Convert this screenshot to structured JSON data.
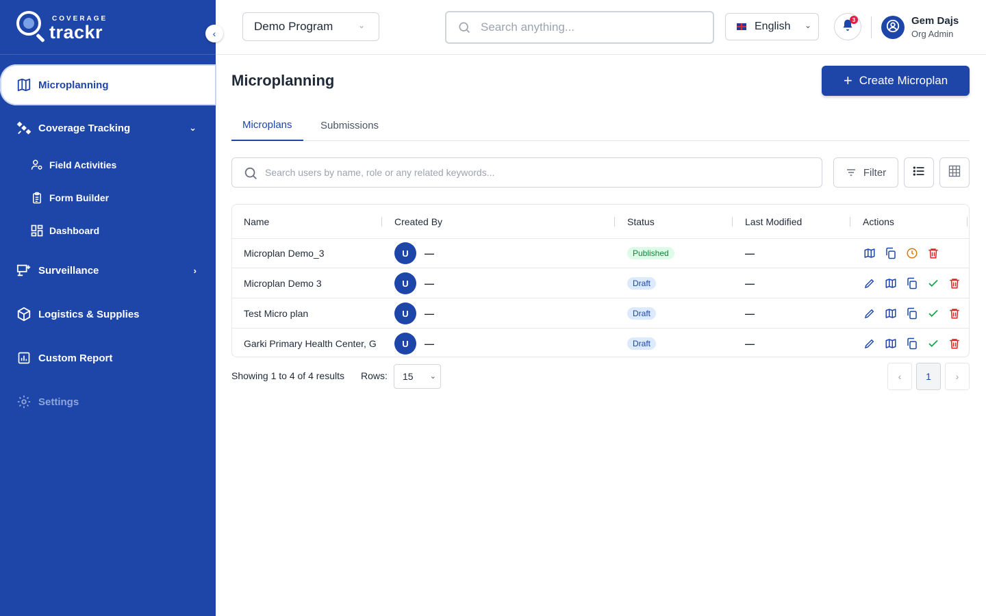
{
  "brand": {
    "sup": "COVERAGE",
    "name": "trackr"
  },
  "sidebar": {
    "collapse_icon": "chevron-left-icon",
    "items": [
      {
        "label": "Microplanning",
        "icon": "map-icon"
      },
      {
        "label": "Coverage Tracking",
        "icon": "satellite-icon",
        "expanded": true
      },
      {
        "label": "Field Activities",
        "icon": "user-cog-icon"
      },
      {
        "label": "Form Builder",
        "icon": "clipboard-icon"
      },
      {
        "label": "Dashboard",
        "icon": "dashboard-icon"
      },
      {
        "label": "Surveillance",
        "icon": "surveillance-icon"
      },
      {
        "label": "Logistics & Supplies",
        "icon": "box-icon"
      },
      {
        "label": "Custom Report",
        "icon": "report-icon"
      },
      {
        "label": "Settings",
        "icon": "gear-icon"
      }
    ]
  },
  "topbar": {
    "program": "Demo Program",
    "search_placeholder": "Search anything...",
    "language": "English",
    "notification_count": "3",
    "user_name": "Gem Dajs",
    "user_role": "Org Admin"
  },
  "main": {
    "title": "Microplanning",
    "create_label": "Create Microplan",
    "tabs": [
      {
        "label": "Microplans",
        "active": true
      },
      {
        "label": "Submissions",
        "active": false
      }
    ],
    "search_placeholder": "Search users by name, role or any related keywords...",
    "filter_label": "Filter"
  },
  "table": {
    "columns": [
      "Name",
      "Created By",
      "Status",
      "Last Modified",
      "Actions"
    ],
    "rows": [
      {
        "name": "Microplan Demo_3",
        "avatar": "U",
        "created_by": "—",
        "status": "Published",
        "last_modified": "—"
      },
      {
        "name": "Microplan Demo 3",
        "avatar": "U",
        "created_by": "—",
        "status": "Draft",
        "last_modified": "—"
      },
      {
        "name": "Test Micro plan",
        "avatar": "U",
        "created_by": "—",
        "status": "Draft",
        "last_modified": "—"
      },
      {
        "name": "Garki Primary Health Center, G",
        "avatar": "U",
        "created_by": "—",
        "status": "Draft",
        "last_modified": "—"
      }
    ]
  },
  "footer": {
    "showing": "Showing 1 to 4 of 4 results",
    "rows_label": "Rows:",
    "rows_value": "15",
    "current_page": "1"
  },
  "colors": {
    "primary": "#1e45a8",
    "published_bg": "#dcfce7",
    "published_text": "#15803d",
    "draft_bg": "#dbeafe",
    "danger": "#dc2626",
    "warning": "#d97706",
    "success": "#16a34a"
  }
}
